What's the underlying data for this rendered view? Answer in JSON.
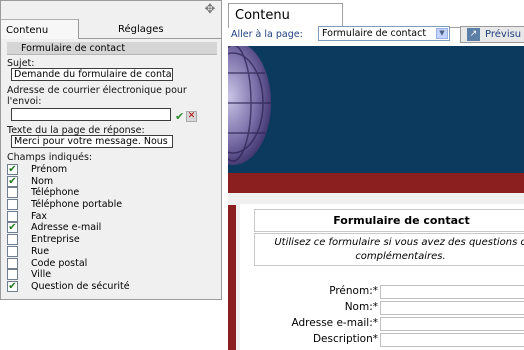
{
  "editor": {
    "tabs": [
      "Contenu",
      "Réglages"
    ],
    "section_title": "Formulaire de contact",
    "subject": {
      "label": "Sujet:",
      "value": "Demande du formulaire de contact"
    },
    "email": {
      "label_line1": "Adresse de courrier électronique pour",
      "label_line2": "l'envoi:",
      "value": ""
    },
    "reply_text": {
      "label": "Texte du la page de réponse:",
      "value": "Merci pour votre message. Nous"
    },
    "fields_label": "Champs indiqués:",
    "fields": [
      {
        "label": "Prénom",
        "checked": true
      },
      {
        "label": "Nom",
        "checked": true
      },
      {
        "label": "Téléphone",
        "checked": false
      },
      {
        "label": "Téléphone portable",
        "checked": false
      },
      {
        "label": "Fax",
        "checked": false
      },
      {
        "label": "Adresse e-mail",
        "checked": true
      },
      {
        "label": "Entreprise",
        "checked": false
      },
      {
        "label": "Rue",
        "checked": false
      },
      {
        "label": "Code postal",
        "checked": false
      },
      {
        "label": "Ville",
        "checked": false
      },
      {
        "label": "Question de sécurité",
        "checked": true
      }
    ]
  },
  "content_tab": "Contenu",
  "goto": {
    "label": "Aller à la page:",
    "selected": "Formulaire de contact"
  },
  "preview_label": "Prévisu",
  "form": {
    "title": "Formulaire de contact",
    "intro_line1": "Utilisez ce formulaire si vous avez des questions o",
    "intro_line2": "complémentaires.",
    "fields": [
      "Prénom:*",
      "Nom:*",
      "Adresse e-mail:*",
      "Description*"
    ]
  },
  "colors": {
    "banner": "#0c3a5e",
    "accent_red": "#8b1e1e",
    "check_green": "#1f7a1f"
  }
}
